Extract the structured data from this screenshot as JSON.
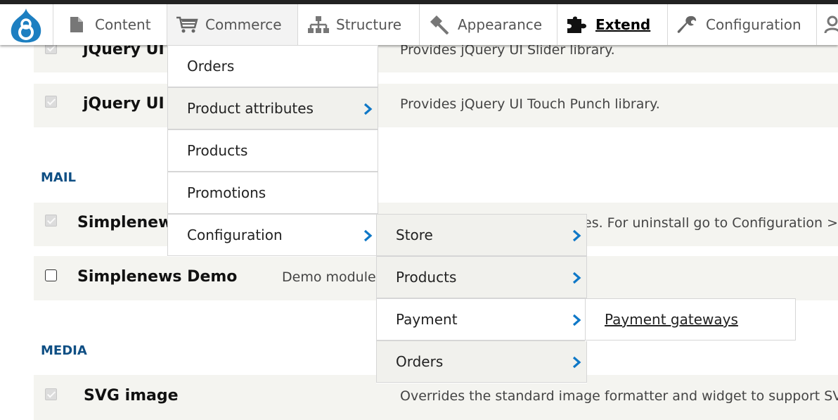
{
  "toolbar": {
    "items": [
      {
        "label": "Content"
      },
      {
        "label": "Commerce"
      },
      {
        "label": "Structure"
      },
      {
        "label": "Appearance"
      },
      {
        "label": "Extend"
      },
      {
        "label": "Configuration"
      }
    ]
  },
  "modules": {
    "row1": {
      "name": "jQuery UI S",
      "description": "Provides jQuery UI Slider library."
    },
    "row2": {
      "name": "jQuery UI T",
      "description": "Provides jQuery UI Touch Punch library."
    },
    "mail_heading": "MAIL",
    "row3": {
      "name": "Simplenews",
      "description": "es. For uninstall go to Configuration >"
    },
    "row4": {
      "name": "Simplenews Demo",
      "description": "Demo module"
    },
    "media_heading": "MEDIA",
    "row5": {
      "name": "SVG image",
      "description": "Overrides the standard image formatter and widget to support SV"
    }
  },
  "commerce_menu": {
    "items": [
      {
        "label": "Orders"
      },
      {
        "label": "Product attributes"
      },
      {
        "label": "Products"
      },
      {
        "label": "Promotions"
      },
      {
        "label": "Configuration"
      }
    ]
  },
  "config_submenu": {
    "items": [
      {
        "label": "Store"
      },
      {
        "label": "Products"
      },
      {
        "label": "Payment"
      },
      {
        "label": "Orders"
      }
    ]
  },
  "payment_submenu": {
    "items": [
      {
        "label": "Payment gateways"
      }
    ]
  },
  "colors": {
    "accent_blue": "#0f78c7",
    "heading_blue": "#0f4f84",
    "row_background": "#f4f4f0"
  }
}
